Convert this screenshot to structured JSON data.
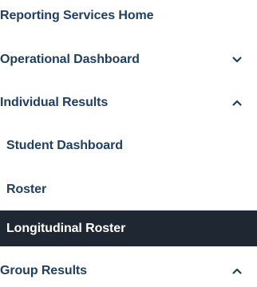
{
  "nav": {
    "items": [
      {
        "label": "Reporting Services Home",
        "level": "top",
        "expandable": false,
        "expanded": false,
        "active": false
      },
      {
        "label": "Operational Dashboard",
        "level": "top",
        "expandable": true,
        "expanded": false,
        "active": false
      },
      {
        "label": "Individual Results",
        "level": "top",
        "expandable": true,
        "expanded": true,
        "active": false
      },
      {
        "label": "Student Dashboard",
        "level": "sub",
        "expandable": false,
        "expanded": false,
        "active": false
      },
      {
        "label": "Roster",
        "level": "sub",
        "expandable": false,
        "expanded": false,
        "active": false
      },
      {
        "label": "Longitudinal Roster",
        "level": "sub",
        "expandable": false,
        "expanded": false,
        "active": true
      },
      {
        "label": "Group Results",
        "level": "top",
        "expandable": true,
        "expanded": true,
        "active": false
      }
    ]
  },
  "colors": {
    "text": "#1f3f63",
    "active_background": "#1f2733",
    "active_text": "#ffffff",
    "background": "#ffffff"
  }
}
